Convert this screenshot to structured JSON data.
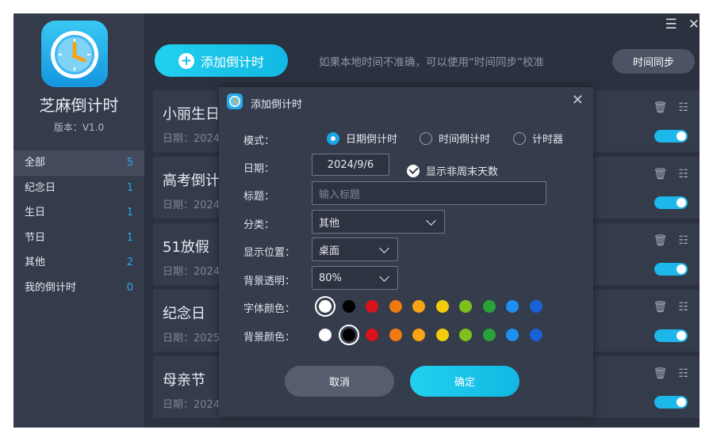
{
  "app": {
    "name": "芝麻倒计时",
    "version": "版本：V1.0"
  },
  "window_controls": {
    "menu": "☰",
    "close": "✕"
  },
  "sidebar": {
    "items": [
      {
        "label": "全部",
        "count": "5"
      },
      {
        "label": "纪念日",
        "count": "1"
      },
      {
        "label": "生日",
        "count": "1"
      },
      {
        "label": "节日",
        "count": "1"
      },
      {
        "label": "其他",
        "count": "2"
      },
      {
        "label": "我的倒计时",
        "count": "0"
      }
    ]
  },
  "toolbar": {
    "add_label": "添加倒计时",
    "hint": "如果本地时间不准确，可以使用“时间同步”校准",
    "sync_label": "时间同步"
  },
  "cards": [
    {
      "title": "小丽生日",
      "date": "日期：2024"
    },
    {
      "title": "高考倒计时",
      "date": "日期：2024"
    },
    {
      "title": "51放假",
      "date": "日期：2024"
    },
    {
      "title": "纪念日",
      "date": "日期：2025"
    },
    {
      "title": "母亲节",
      "date": "日期：2024"
    }
  ],
  "dialog": {
    "title": "添加倒计时",
    "mode_label": "模式：",
    "mode_options": [
      "日期倒计时",
      "时间倒计时",
      "计时器"
    ],
    "mode_selected": "日期倒计时",
    "date_label": "日期：",
    "date_value": "2024/9/6",
    "show_weekend_label": "显示非周末天数",
    "title_label": "标题：",
    "title_placeholder": "输入标题",
    "category_label": "分类：",
    "category_value": "其他",
    "position_label": "显示位置：",
    "position_value": "桌面",
    "opacity_label": "背景透明：",
    "opacity_value": "80%",
    "font_color_label": "字体颜色：",
    "bg_color_label": "背景颜色：",
    "colors": [
      "#ffffff",
      "#000000",
      "#d9121b",
      "#f07a12",
      "#f7a515",
      "#f2cc0c",
      "#7ec11d",
      "#2aa23a",
      "#1e8ff0",
      "#1762d6"
    ],
    "font_color_selected": "#ffffff",
    "bg_color_selected": "#000000",
    "cancel_label": "取消",
    "ok_label": "确定"
  }
}
